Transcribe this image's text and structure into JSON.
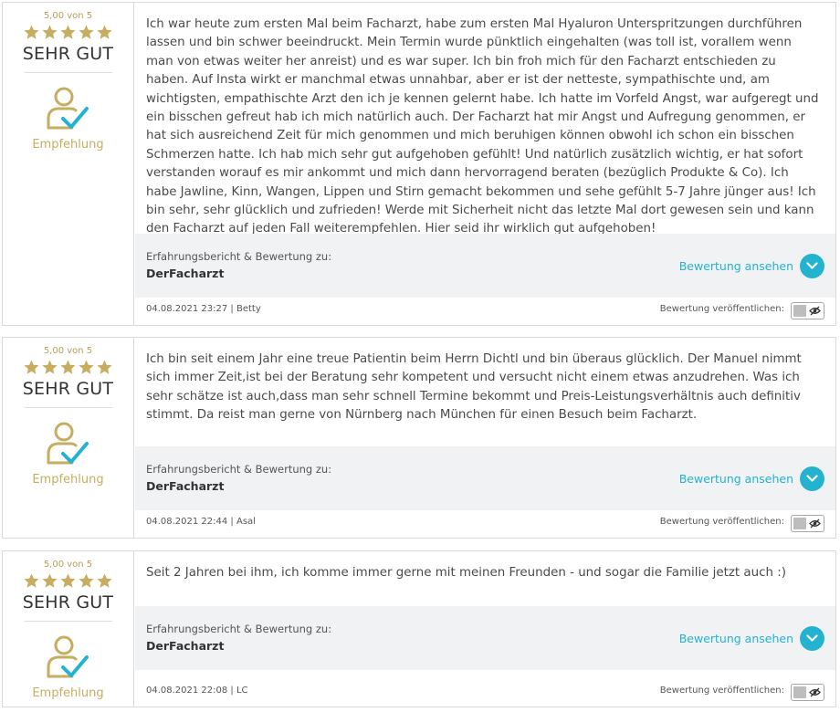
{
  "accent_color": "#23b2cf",
  "star_color": "#c6ad60",
  "reviews": [
    {
      "rating_text": "5,00 von 5",
      "stars": 5,
      "grade": "SEHR GUT",
      "recommendation": "Empfehlung",
      "text": "Ich war heute zum ersten Mal beim Facharzt, habe zum ersten Mal Hyaluron Unterspritzungen durchführen lassen und bin schwer beeindruckt. Mein Termin wurde pünktlich eingehalten (was toll ist, vorallem wenn man von etwas weiter her anreist) und es war super. Ich bin froh mich für den Facharzt entschieden zu haben. Auf Insta wirkt er manchmal etwas unnahbar, aber er ist der netteste, sympathischte und, am wichtigsten, empathischte Arzt den ich je kennen gelernt habe. Ich hatte im Vorfeld Angst, war aufgeregt und ein bisschen gefreut hab ich mich natürlich auch. Der Facharzt hat mir Angst und Aufregung genommen, er hat sich ausreichend Zeit für mich genommen und mich beruhigen können obwohl ich schon ein bisschen Schmerzen hatte. Ich hab mich sehr gut aufgehoben gefühlt! Und natürlich zusätzlich wichtig, er hat sofort verstanden worauf es mir ankommt und mich dann hervorragend beraten (bezüglich Produkte & Co). Ich habe Jawline, Kinn, Wangen, Lippen und Stirn gemacht bekommen und sehe gefühlt 5-7 Jahre jünger aus! Ich bin sehr, sehr glücklich und zufrieden! Werde mit Sicherheit nicht das letzte Mal dort gewesen sein und kann den Facharzt auf jeden Fall weiterempfehlen. Hier seid ihr wirklich gut aufgehoben!",
      "subject_label": "Erfahrungsbericht & Bewertung zu:",
      "subject_name": "DerFacharzt",
      "view_label": "Bewertung ansehen",
      "meta": "04.08.2021 23:27 | Betty",
      "publish_label": "Bewertung veröffentlichen:"
    },
    {
      "rating_text": "5,00 von 5",
      "stars": 5,
      "grade": "SEHR GUT",
      "recommendation": "Empfehlung",
      "text": "Ich bin seit einem Jahr eine treue Patientin beim Herrn Dichtl und bin überaus glücklich. Der Manuel nimmt sich immer Zeit,ist bei der Beratung sehr kompetent und versucht nicht einem etwas anzudrehen. Was ich sehr schätze ist auch,dass man sehr schnell Termine bekommt und Preis-Leistungsverhältnis auch definitiv stimmt. Da reist man gerne von Nürnberg nach München für einen Besuch beim Facharzt.",
      "subject_label": "Erfahrungsbericht & Bewertung zu:",
      "subject_name": "DerFacharzt",
      "view_label": "Bewertung ansehen",
      "meta": "04.08.2021 22:44 | Asal",
      "publish_label": "Bewertung veröffentlichen:"
    },
    {
      "rating_text": "5,00 von 5",
      "stars": 5,
      "grade": "SEHR GUT",
      "recommendation": "Empfehlung",
      "text": "Seit 2 Jahren bei ihm, ich komme immer gerne mit meinen Freunden - und sogar die Familie jetzt auch :)",
      "subject_label": "Erfahrungsbericht & Bewertung zu:",
      "subject_name": "DerFacharzt",
      "view_label": "Bewertung ansehen",
      "meta": "04.08.2021 22:08 | LC",
      "publish_label": "Bewertung veröffentlichen:"
    }
  ]
}
